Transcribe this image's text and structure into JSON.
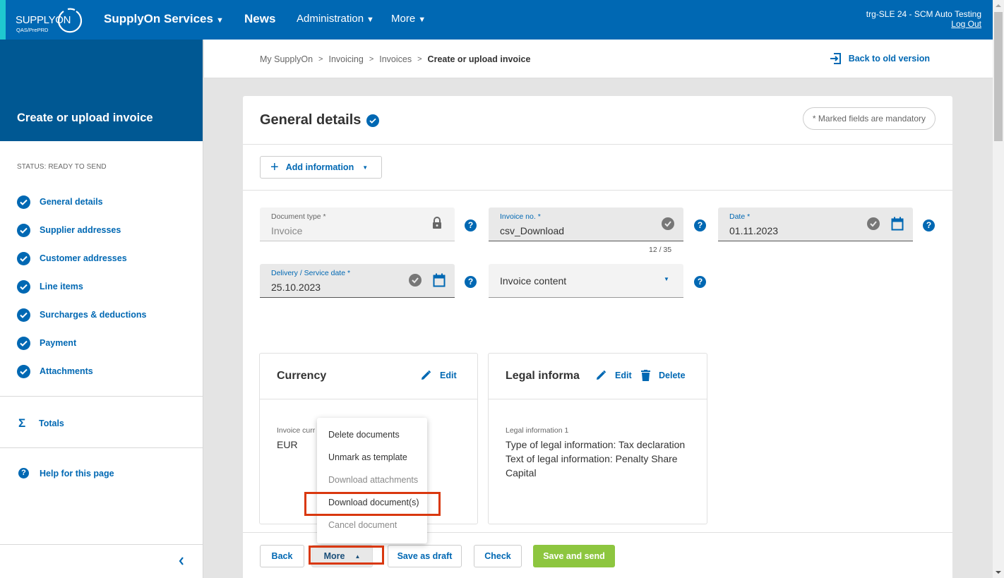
{
  "topbar": {
    "logo_text": "SUPPLYON",
    "logo_env": "QAS/PrePRD",
    "nav": [
      {
        "label": "SupplyOn Services",
        "caret": "▼"
      },
      {
        "label": "News"
      },
      {
        "label": "Administration",
        "caret": "▼"
      },
      {
        "label": "More",
        "caret": "▼"
      }
    ],
    "user": "trg-SLE 24 - SCM Auto Testing",
    "logout": "Log Out"
  },
  "sidebar": {
    "title": "Create or upload invoice",
    "status": "STATUS: READY TO SEND",
    "steps": [
      {
        "label": "General details",
        "complete": true
      },
      {
        "label": "Supplier addresses",
        "complete": true
      },
      {
        "label": "Customer addresses",
        "complete": true
      },
      {
        "label": "Line items",
        "complete": true
      },
      {
        "label": "Surcharges & deductions",
        "complete": true
      },
      {
        "label": "Payment",
        "complete": true
      },
      {
        "label": "Attachments",
        "complete": true
      }
    ],
    "totals": "Totals",
    "help": "Help for this page"
  },
  "breadcrumb": {
    "items": [
      "My SupplyOn",
      "Invoicing",
      "Invoices"
    ],
    "current": "Create or upload invoice",
    "separator": ">"
  },
  "back_old_version": "Back to old version",
  "section": {
    "title": "General details",
    "mandatory_note": "* Marked fields are mandatory",
    "add_information": "Add information"
  },
  "fields": {
    "document_type": {
      "label": "Document type *",
      "value": "Invoice",
      "locked": true
    },
    "invoice_no": {
      "label": "Invoice no. *",
      "value": "csv_Download",
      "counter": "12 / 35"
    },
    "date": {
      "label": "Date *",
      "value": "01.11.2023"
    },
    "delivery_date": {
      "label": "Delivery / Service date *",
      "value": "25.10.2023"
    },
    "invoice_content": {
      "placeholder": "Invoice content"
    }
  },
  "currency_card": {
    "title": "Currency",
    "edit": "Edit",
    "label": "Invoice curr",
    "value": "EUR"
  },
  "legal_card": {
    "title": "Legal informa",
    "edit": "Edit",
    "delete": "Delete",
    "label": "Legal information 1",
    "lines": [
      "Type of legal information: Tax declaration",
      "Text of legal information: Penalty Share",
      "Capital"
    ]
  },
  "more_menu": {
    "items": [
      {
        "label": "Delete documents",
        "enabled": true
      },
      {
        "label": "Unmark as template",
        "enabled": true
      },
      {
        "label": "Download attachments",
        "enabled": false
      },
      {
        "label": "Download document(s)",
        "enabled": true,
        "highlighted": true
      },
      {
        "label": "Cancel document",
        "enabled": false
      }
    ]
  },
  "footer": {
    "back": "Back",
    "more": "More",
    "more_caret": "▲",
    "save_draft": "Save as draft",
    "check": "Check",
    "save_send": "Save and send"
  },
  "colors": {
    "brand": "#0068b3",
    "sidebar_header": "#005893",
    "accent": "#1fc8d0",
    "primary_button": "#8dc63f",
    "highlight": "#d9380f"
  }
}
